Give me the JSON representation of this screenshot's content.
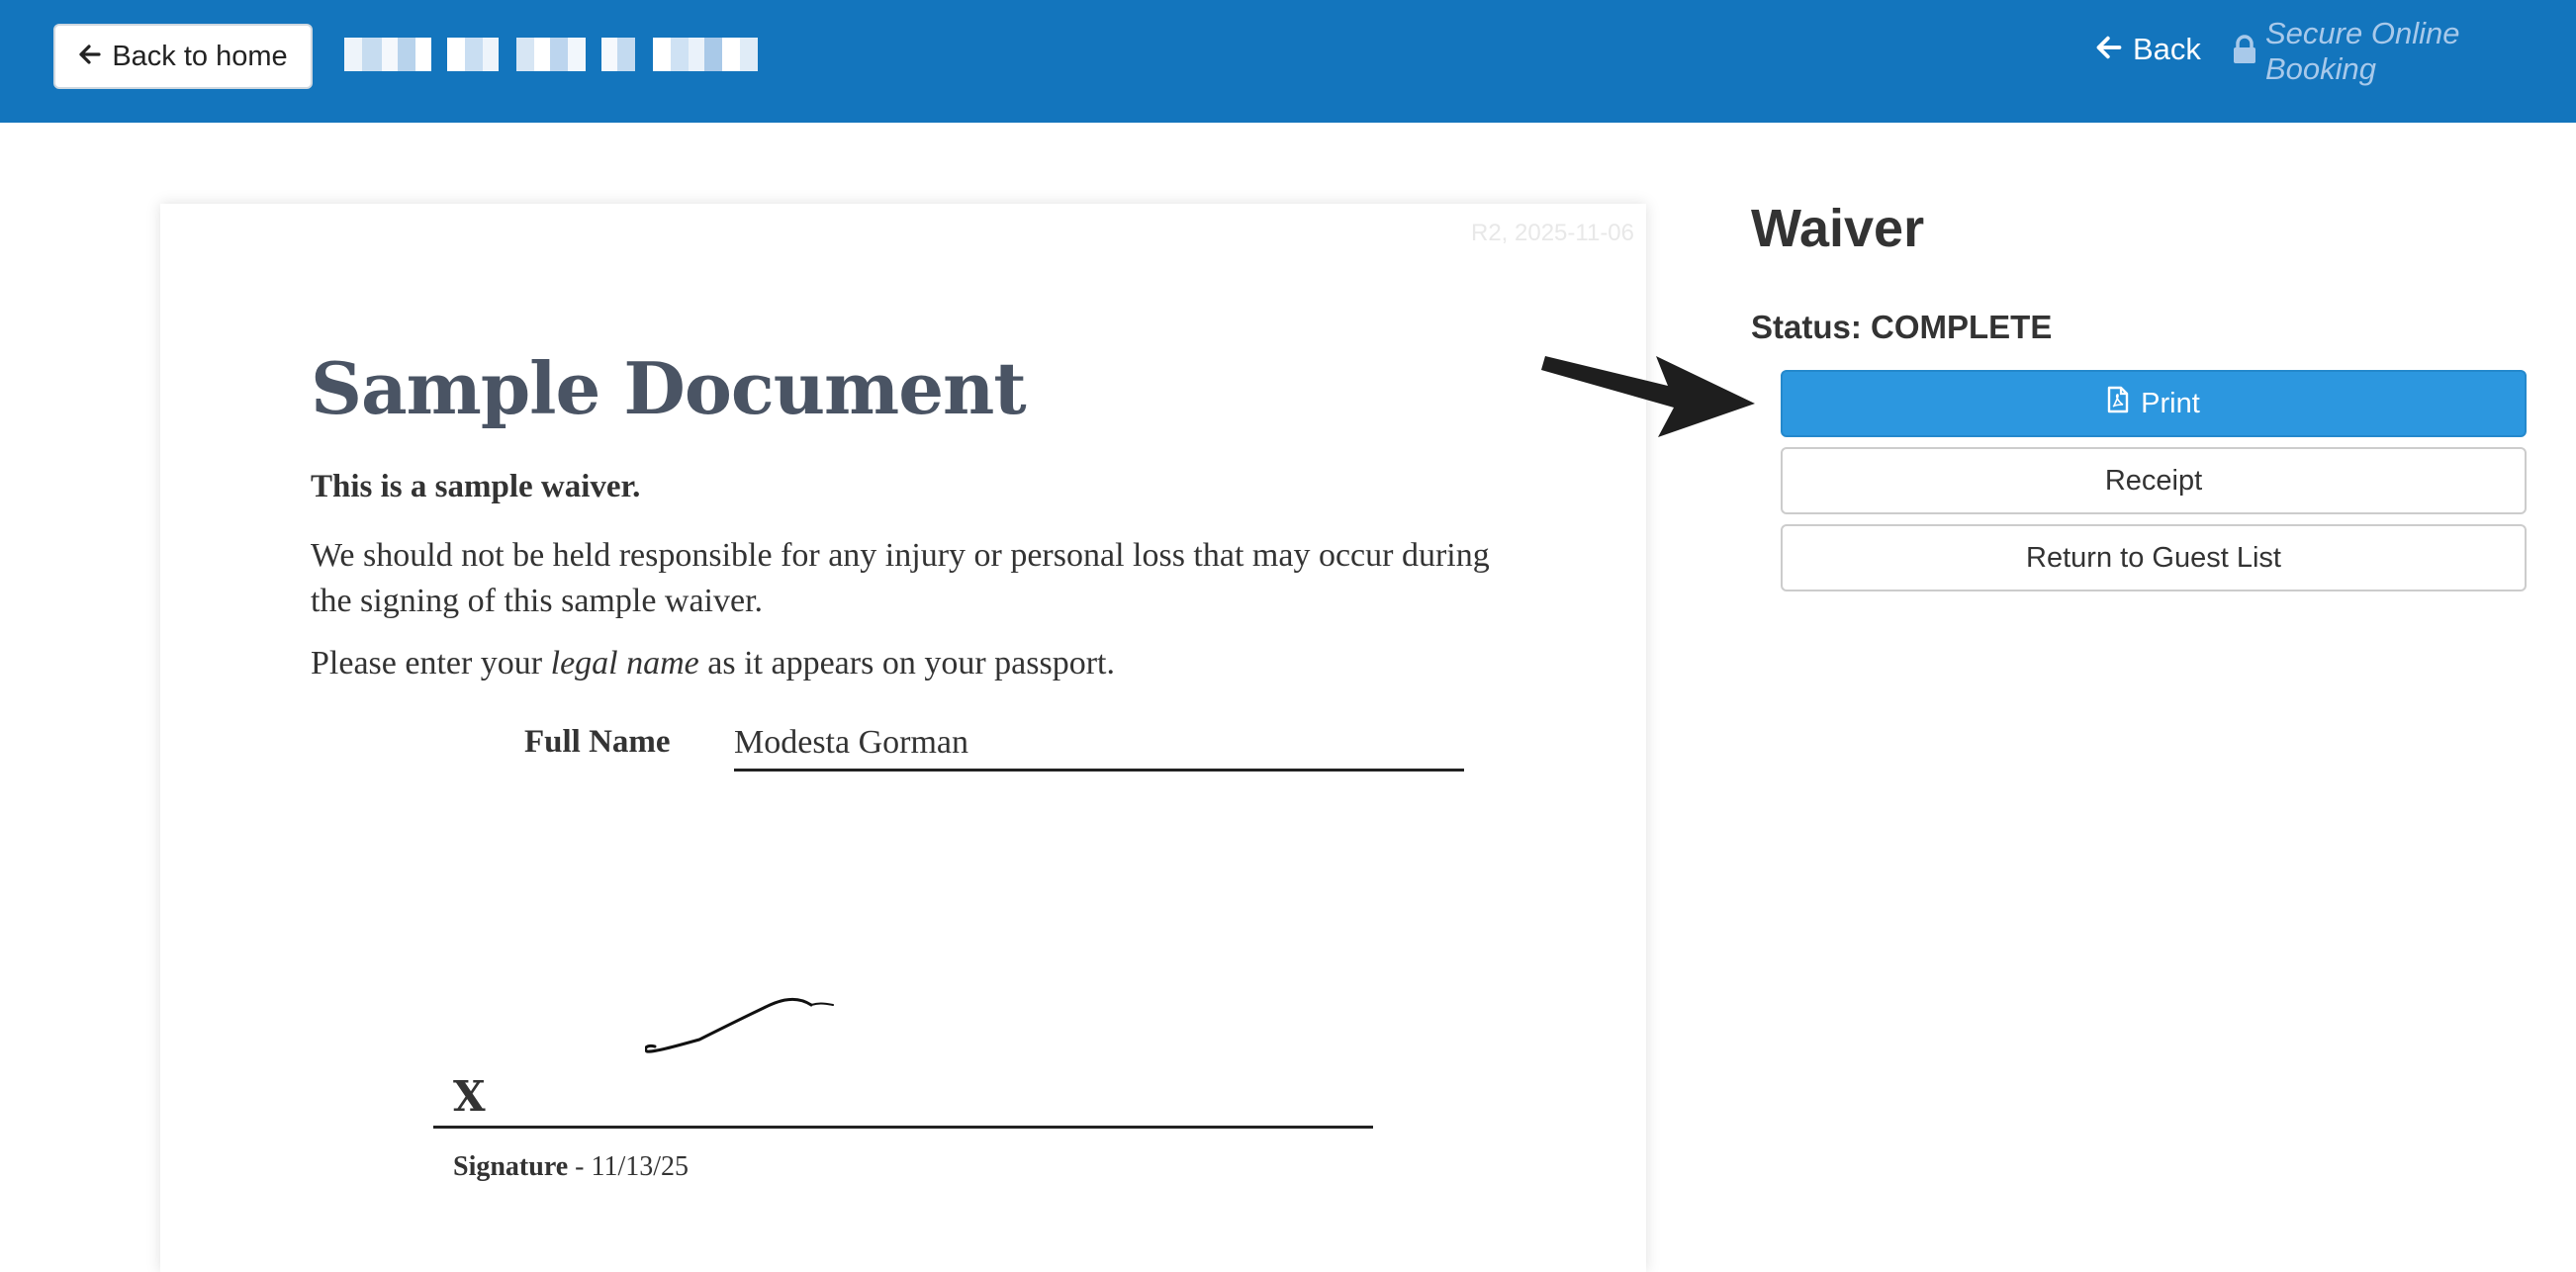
{
  "header": {
    "home_button_label": "Back to home",
    "back_label": "Back",
    "secure_label": "Secure Online Booking"
  },
  "document": {
    "revision": "R2, 2025-11-06",
    "title": "Sample Document",
    "intro_bold": "This is a sample waiver.",
    "body_text": "We should not be held responsible for any injury or personal loss that may occur during the signing of this sample waiver.",
    "instruction_before": "Please enter your ",
    "instruction_emphasis": "legal name",
    "instruction_after": " as it appears on your passport.",
    "full_name_label": "Full Name",
    "full_name_value": "Modesta Gorman",
    "signature_mark": "X",
    "signature_label": "Signature",
    "signature_date": " - 11/13/25"
  },
  "panel": {
    "heading": "Waiver",
    "status_text": "Status: COMPLETE",
    "buttons": {
      "print": "Print",
      "receipt": "Receipt",
      "return_to_list": "Return to Guest List"
    }
  },
  "colors": {
    "header_bg": "#1375bd",
    "primary_button": "#2c97df",
    "title_text": "#4a5464"
  },
  "icons": {
    "home_button": "arrow-left-icon",
    "back": "arrow-left-icon",
    "secure": "lock-icon",
    "print": "pdf-file-icon"
  }
}
